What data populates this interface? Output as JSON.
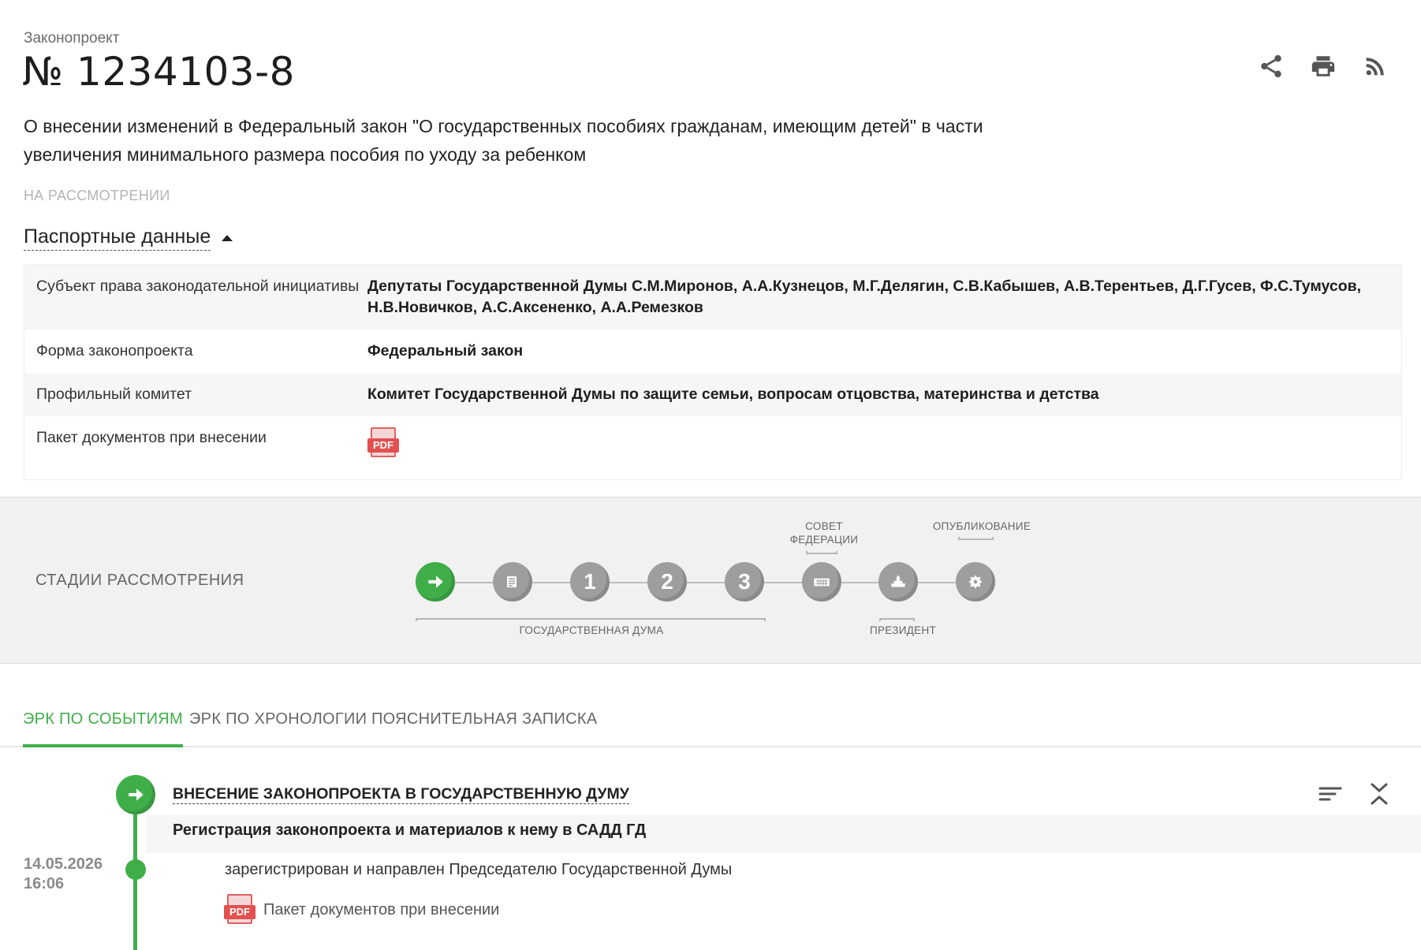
{
  "header": {
    "kicker": "Законопроект",
    "number": "№ 1234103-8",
    "title": "О внесении изменений в Федеральный закон \"О государственных пособиях гражданам, имеющим детей\" в части увеличения минимального размера пособия по уходу за ребенком",
    "status": "НА РАССМОТРЕНИИ",
    "actions": [
      "share-icon",
      "print-icon",
      "rss-icon"
    ]
  },
  "passport": {
    "toggle_label": "Паспортные данные",
    "rows": [
      {
        "key": "Субъект права законодательной инициативы",
        "value": "Депутаты Государственной Думы С.М.Миронов, А.А.Кузнецов, М.Г.Делягин, С.В.Кабышев, А.В.Терентьев, Д.Г.Гусев, Ф.С.Тумусов, Н.В.Новичков, А.С.Аксененко, А.А.Ремезков"
      },
      {
        "key": "Форма законопроекта",
        "value": "Федеральный закон"
      },
      {
        "key": "Профильный комитет",
        "value": "Комитет Государственной Думы по защите семьи, вопросам отцовства, материнства и детства"
      },
      {
        "key": "Пакет документов при внесении",
        "value": ""
      }
    ],
    "pdf_label": "PDF"
  },
  "stages": {
    "title": "СТАДИИ РАССМОТРЕНИЯ",
    "steps": [
      {
        "icon": "arrow-right-icon",
        "label": "",
        "active": true
      },
      {
        "icon": "document-list-icon",
        "label": "",
        "active": false
      },
      {
        "icon": "",
        "label": "1",
        "active": false
      },
      {
        "icon": "",
        "label": "2",
        "active": false
      },
      {
        "icon": "",
        "label": "3",
        "active": false
      },
      {
        "icon": "keyboard-icon",
        "label": "",
        "active": false
      },
      {
        "icon": "building-icon",
        "label": "",
        "active": false
      },
      {
        "icon": "emblem-icon",
        "label": "",
        "active": false
      }
    ],
    "group_duma": "ГОСУДАРСТВЕННАЯ ДУМА",
    "group_council": "СОВЕТ\nФЕДЕРАЦИИ",
    "group_president": "ПРЕЗИДЕНТ",
    "group_publication": "ОПУБЛИКОВАНИЕ"
  },
  "tabs": [
    {
      "label": "ЭРК ПО СОБЫТИЯМ",
      "active": true
    },
    {
      "label": "ЭРК ПО ХРОНОЛОГИИ",
      "active": false
    },
    {
      "label": "ПОЯСНИТЕЛЬНАЯ ЗАПИСКА",
      "active": false
    }
  ],
  "events": {
    "stage_title": "ВНЕСЕНИЕ ЗАКОНОПРОЕКТА В ГОСУДАРСТВЕННУЮ ДУМУ",
    "substage_title": "Регистрация законопроекта и материалов к нему в САДД ГД",
    "date": "14.05.2026",
    "time": "16:06",
    "description": "зарегистрирован и направлен Председателю Государственной Думы",
    "document_label": "Пакет документов при внесении",
    "tools": [
      "filter-lines-icon",
      "collapse-icon"
    ]
  },
  "colors": {
    "accent": "#3fae49",
    "pdf": "#e25050",
    "stage_inactive": "#9e9e9e",
    "band": "#f1f1f1"
  }
}
